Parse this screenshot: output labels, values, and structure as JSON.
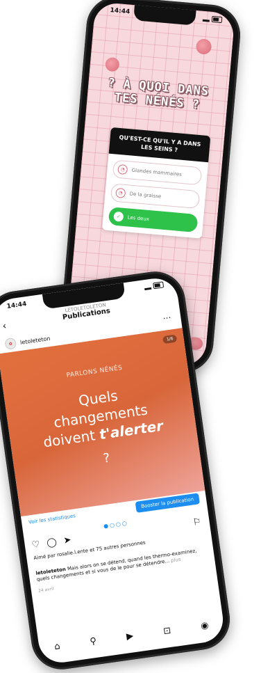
{
  "quiz_phone": {
    "status_time": "14:44",
    "title_line1": "? À QUOI DANS",
    "title_line2": "TES NÉNÉS ?",
    "question": "QU'EST-CE QU'IL Y A DANS LES SEINS ?",
    "options": [
      {
        "label": "Glandes mammaires",
        "state": "neutral"
      },
      {
        "label": "De la graisse",
        "state": "neutral"
      },
      {
        "label": "Les deux",
        "state": "correct"
      }
    ],
    "colors": {
      "background": "#f7d8dd",
      "accent": "#e06a7c",
      "correct": "#2ec24a"
    }
  },
  "insta_phone": {
    "status_time": "14:44",
    "header_sub": "LETOLETOLETON",
    "header_title": "Publications",
    "back_icon": "chevron-left-icon",
    "username": "letoleteton",
    "more_icon": "more-icon",
    "post": {
      "counter": "1/6",
      "tag": "PARLONS NÉNÉS",
      "line1": "Quels",
      "line2": "changements",
      "line3_plain": "doivent ",
      "line3_bold": "t'alerter",
      "question_mark": "?"
    },
    "stats_link": "Voir les statistiques",
    "boost_button": "Booster la publication",
    "likes_text": "Aimé par rosalie.l.ente et 75 autres personnes",
    "caption_user": "letoleteton",
    "caption_text": "Mais alors on se détend, quand les thermo-examinez, quels changements et si vous de le pour se détendre... ",
    "caption_more": "plus",
    "date": "24 avril",
    "colors": {
      "post_start": "#e2703e",
      "post_end": "#efa39a",
      "link": "#1d8ef0"
    }
  }
}
